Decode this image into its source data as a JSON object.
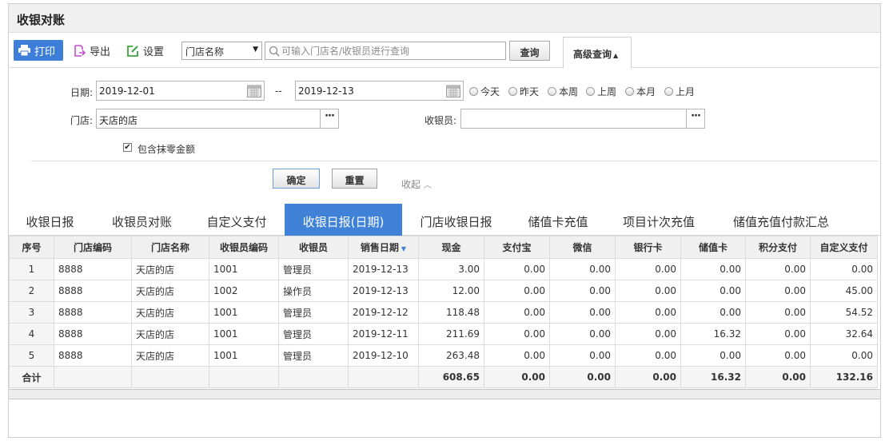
{
  "window": {
    "title": "收银对账"
  },
  "toolbar": {
    "print_label": "打印",
    "export_label": "导出",
    "settings_label": "设置",
    "search_field": {
      "value": "门店名称"
    },
    "search": {
      "placeholder": "可输入门店名/收银员进行查询"
    },
    "query_label": "查询",
    "advanced_label": "高级查询"
  },
  "advanced": {
    "date_label": "日期:",
    "start_date": "2019-12-01",
    "range_sep": "--",
    "end_date": "2019-12-13",
    "quick_ranges": [
      "今天",
      "昨天",
      "本周",
      "上周",
      "本月",
      "上月"
    ],
    "store_label": "门店:",
    "store_value": "天店的店",
    "cashier_label": "收银员:",
    "cashier_value": "",
    "include_rounding_label": "包含抹零金额",
    "include_rounding_checked": true,
    "confirm_label": "确定",
    "reset_label": "重置",
    "collapse_label": "收起"
  },
  "tabs": [
    {
      "label": "收银日报",
      "active": false
    },
    {
      "label": "收银员对账",
      "active": false
    },
    {
      "label": "自定义支付",
      "active": false
    },
    {
      "label": "收银日报(日期)",
      "active": true
    },
    {
      "label": "门店收银日报",
      "active": false
    },
    {
      "label": "储值卡充值",
      "active": false
    },
    {
      "label": "项目计次充值",
      "active": false
    },
    {
      "label": "储值充值付款汇总",
      "active": false
    }
  ],
  "table": {
    "columns": [
      "序号",
      "门店编码",
      "门店名称",
      "收银员编码",
      "收银员",
      "销售日期",
      "现金",
      "支付宝",
      "微信",
      "银行卡",
      "储值卡",
      "积分支付",
      "自定义支付"
    ],
    "rows": [
      [
        "1",
        "8888",
        "天店的店",
        "1001",
        "管理员",
        "2019-12-13",
        "3.00",
        "0.00",
        "0.00",
        "0.00",
        "0.00",
        "0.00",
        "0.00"
      ],
      [
        "2",
        "8888",
        "天店的店",
        "1002",
        "操作员",
        "2019-12-13",
        "12.00",
        "0.00",
        "0.00",
        "0.00",
        "0.00",
        "0.00",
        "45.00"
      ],
      [
        "3",
        "8888",
        "天店的店",
        "1001",
        "管理员",
        "2019-12-12",
        "118.48",
        "0.00",
        "0.00",
        "0.00",
        "0.00",
        "0.00",
        "54.52"
      ],
      [
        "4",
        "8888",
        "天店的店",
        "1001",
        "管理员",
        "2019-12-11",
        "211.69",
        "0.00",
        "0.00",
        "0.00",
        "16.32",
        "0.00",
        "32.64"
      ],
      [
        "5",
        "8888",
        "天店的店",
        "1001",
        "管理员",
        "2019-12-10",
        "263.48",
        "0.00",
        "0.00",
        "0.00",
        "0.00",
        "0.00",
        "0.00"
      ]
    ],
    "total_label": "合计",
    "totals": [
      "",
      "",
      "",
      "",
      "",
      "608.65",
      "0.00",
      "0.00",
      "0.00",
      "16.32",
      "0.00",
      "132.16"
    ]
  },
  "colors": {
    "accent": "#3f82d8",
    "header_bg": "#f0f0f0"
  }
}
